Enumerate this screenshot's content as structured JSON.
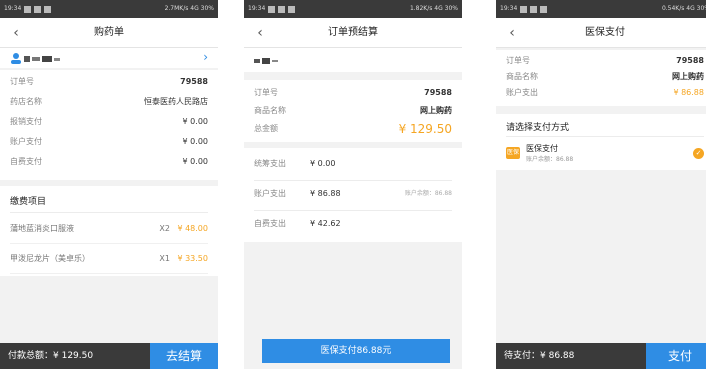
{
  "status": {
    "p1": {
      "time": "19:34",
      "right": "2.7MK/s 4G 30%"
    },
    "p2": {
      "time": "19:34",
      "right": "1.82K/s 4G 30%"
    },
    "p3": {
      "time": "19:34",
      "right": "0.54K/s 4G 30%"
    }
  },
  "p1": {
    "title": "购药单",
    "rows": [
      {
        "k": "订单号",
        "v": "79588"
      },
      {
        "k": "药店名称",
        "v": "恒泰医药人民路店"
      },
      {
        "k": "报销支付",
        "v": "¥ 0.00"
      },
      {
        "k": "账户支付",
        "v": "¥ 0.00"
      },
      {
        "k": "自费支付",
        "v": "¥ 0.00"
      }
    ],
    "section": "缴费项目",
    "items": [
      {
        "name": "蒲地蓝消炎口服液",
        "qty": "X2",
        "price": "¥ 48.00"
      },
      {
        "name": "甲泼尼龙片（美卓乐）",
        "qty": "X1",
        "price": "¥ 33.50"
      }
    ],
    "total_label": "付款总额：¥ 129.50",
    "btn": "去结算"
  },
  "p2": {
    "title": "订单预结算",
    "rows": [
      {
        "k": "订单号",
        "v": "79588"
      },
      {
        "k": "商品名称",
        "v": "网上购药"
      },
      {
        "k": "总金额",
        "v": "¥ 129.50"
      }
    ],
    "rows2": [
      {
        "k": "统筹支出",
        "v": "¥ 0.00",
        "note": ""
      },
      {
        "k": "账户支出",
        "v": "¥ 86.88",
        "note": "账户余额：86.88"
      },
      {
        "k": "自费支出",
        "v": "¥ 42.62",
        "note": ""
      }
    ],
    "btn": "医保支付86.88元"
  },
  "p3": {
    "title": "医保支付",
    "rows": [
      {
        "k": "订单号",
        "v": "79588"
      },
      {
        "k": "商品名称",
        "v": "网上购药"
      },
      {
        "k": "账户支出",
        "v": "¥ 86.88"
      }
    ],
    "section": "请选择支付方式",
    "method": {
      "name": "医保支付",
      "balance": "账户余额：86.88",
      "icon_text": "医保"
    },
    "total_label": "待支付：¥ 86.88",
    "btn": "支付"
  },
  "colors": {
    "accent": "#2f8de4",
    "orange": "#f5a623",
    "footer": "#3a3a3a"
  }
}
